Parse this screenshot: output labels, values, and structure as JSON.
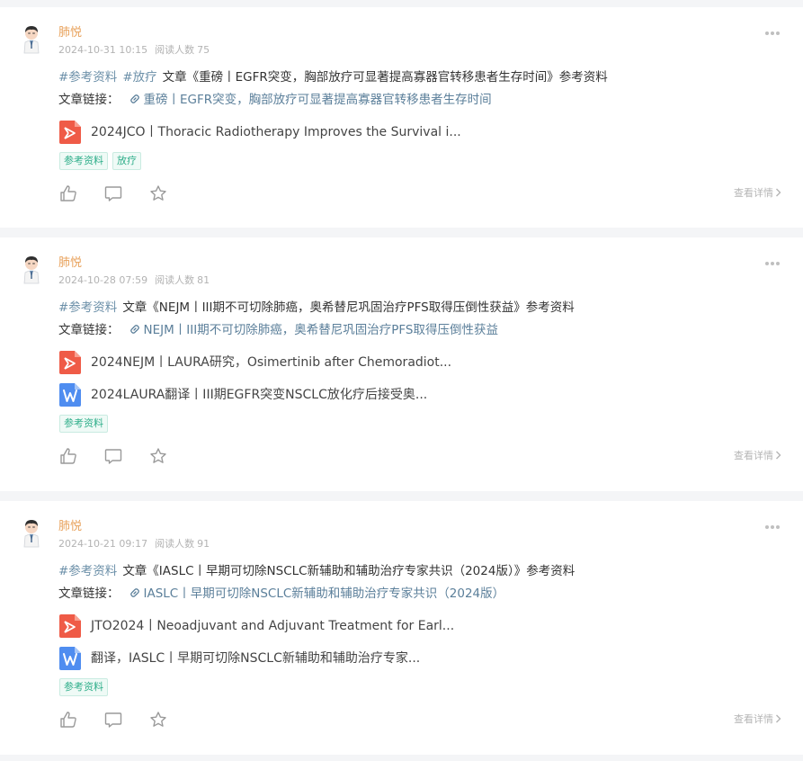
{
  "posts": [
    {
      "author": "肺悦",
      "date": "2024-10-31 10:15",
      "read_label": "阅读人数",
      "read_count": "75",
      "title_tags": [
        "#参考资料",
        "#放疗"
      ],
      "title_text": "文章《重磅丨EGFR突变，胸部放疗可显著提高寡器官转移患者生存时间》参考资料",
      "link_label": "文章链接：",
      "link_text": "重磅丨EGFR突变，胸部放疗可显著提高寡器官转移患者生存时间",
      "files": [
        {
          "type": "pdf",
          "name": "2024JCO丨Thoracic Radiotherapy Improves the Survival i..."
        }
      ],
      "badges": [
        "参考资料",
        "放疗"
      ],
      "detail_label": "查看详情"
    },
    {
      "author": "肺悦",
      "date": "2024-10-28 07:59",
      "read_label": "阅读人数",
      "read_count": "81",
      "title_tags": [
        "#参考资料"
      ],
      "title_text": "文章《NEJM丨III期不可切除肺癌，奥希替尼巩固治疗PFS取得压倒性获益》参考资料",
      "link_label": "文章链接：",
      "link_text": "NEJM丨III期不可切除肺癌，奥希替尼巩固治疗PFS取得压倒性获益",
      "files": [
        {
          "type": "pdf",
          "name": "2024NEJM丨LAURA研究，Osimertinib after Chemoradiot..."
        },
        {
          "type": "word",
          "name": "2024LAURA翻译丨III期EGFR突变NSCLC放化疗后接受奥..."
        }
      ],
      "badges": [
        "参考资料"
      ],
      "detail_label": "查看详情"
    },
    {
      "author": "肺悦",
      "date": "2024-10-21 09:17",
      "read_label": "阅读人数",
      "read_count": "91",
      "title_tags": [
        "#参考资料"
      ],
      "title_text": "文章《IASLC丨早期可切除NSCLC新辅助和辅助治疗专家共识（2024版）》参考资料",
      "link_label": "文章链接：",
      "link_text": "IASLC丨早期可切除NSCLC新辅助和辅助治疗专家共识（2024版）",
      "files": [
        {
          "type": "pdf",
          "name": "JTO2024丨Neoadjuvant and Adjuvant Treatment for Earl..."
        },
        {
          "type": "word",
          "name": "翻译，IASLC丨早期可切除NSCLC新辅助和辅助治疗专家..."
        }
      ],
      "badges": [
        "参考资料"
      ],
      "detail_label": "查看详情"
    }
  ],
  "colors": {
    "author": "#e8a25c",
    "tag": "#6b8fa8",
    "link": "#5b7f9a",
    "badge_text": "#2fae8a",
    "pdf_icon": "#ef5b47",
    "word_icon": "#4f8df0"
  },
  "icons": {
    "avatar": "doctor-avatar-icon",
    "more": "more-dots-icon",
    "link": "link-chain-icon",
    "pdf": "pdf-file-icon",
    "word": "word-file-icon",
    "like": "thumbs-up-icon",
    "comment": "comment-icon",
    "favorite": "star-icon",
    "arrow": "chevron-right-icon"
  }
}
